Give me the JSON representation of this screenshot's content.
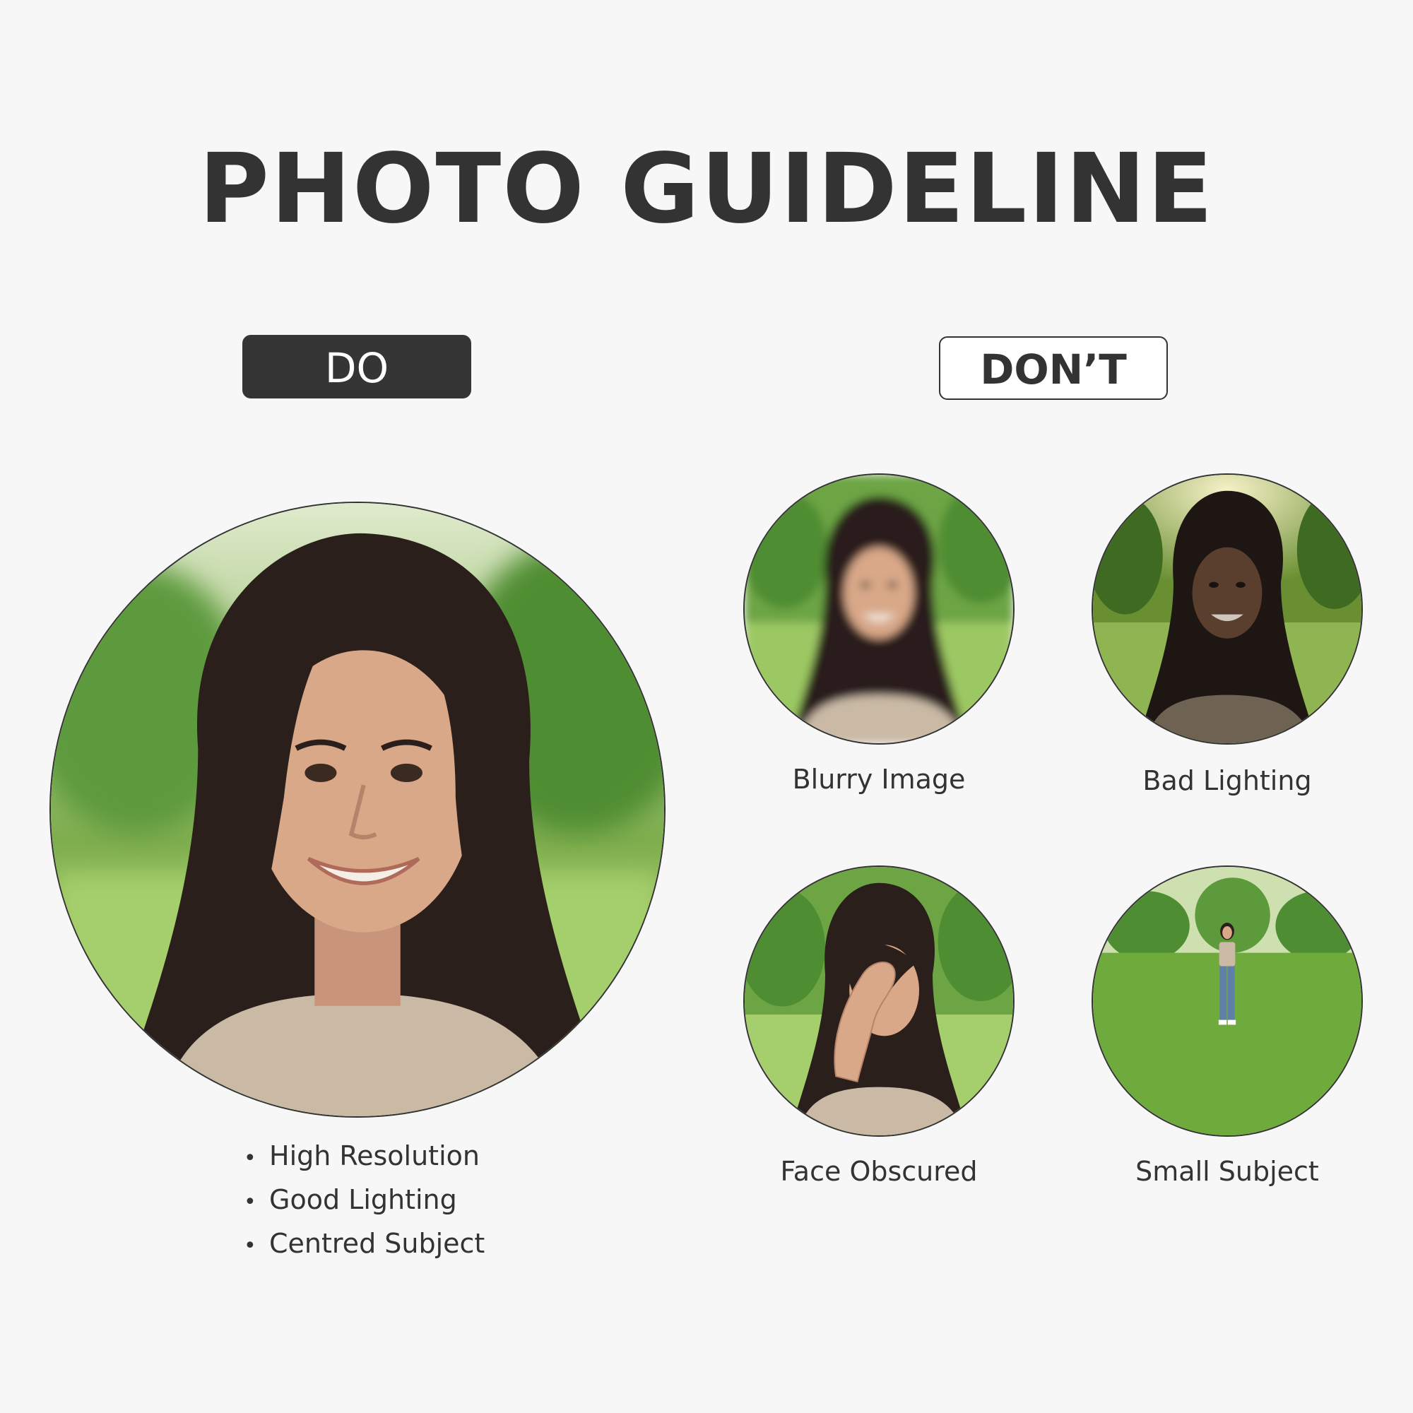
{
  "title": "PHOTO GUIDELINE",
  "do_label": "DO",
  "dont_label": "DON’T",
  "do_points": [
    "High Resolution",
    "Good Lighting",
    "Centred Subject"
  ],
  "dont_examples": [
    {
      "caption": "Blurry Image"
    },
    {
      "caption": "Bad Lighting"
    },
    {
      "caption": "Face Obscured"
    },
    {
      "caption": "Small Subject"
    }
  ],
  "colors": {
    "background": "#f7f7f7",
    "text": "#333333",
    "do_tag_fill": "#353535",
    "grass": "#8cbd55",
    "foliage": "#5d9a3c",
    "hair": "#2a1f1a",
    "shirt": "#c9b9a5",
    "skin": "#d8a888"
  }
}
